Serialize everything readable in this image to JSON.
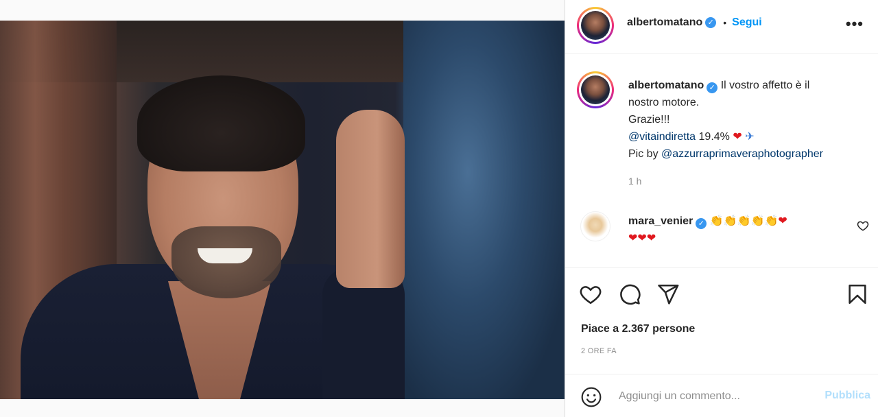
{
  "post": {
    "author": "albertomatano",
    "follow_label": "Segui",
    "dot": "•",
    "more_label": "•••"
  },
  "caption": {
    "author": "albertomatano",
    "line1": "Il vostro affetto è il",
    "line2": "nostro motore.",
    "line3": "Grazie!!!",
    "mention1": "@vitaindiretta",
    "stat": "19.4%",
    "heart": "❤",
    "plane": "✈",
    "pic_by": "Pic by",
    "mention2": "@azzurraprimaveraphotographer",
    "time": "1 h"
  },
  "comment": {
    "author": "mara_venier",
    "clap_emojis": "👏👏👏👏👏",
    "hearts_inline": "❤",
    "hearts_line2": "❤❤❤"
  },
  "likes": "Piace a 2.367 persone",
  "posted_ago": "2 ORE FA",
  "add_comment": {
    "placeholder": "Aggiungi un commento...",
    "publish_label": "Pubblica"
  },
  "icons": {
    "like": "heart-icon",
    "comment": "comment-icon",
    "share": "share-icon",
    "save": "bookmark-icon",
    "emoji": "emoji-icon",
    "verified": "verified-badge-icon"
  },
  "colors": {
    "link": "#0095f6",
    "mention": "#00376b",
    "verified": "#3897f0",
    "publish_disabled": "#b2dffc",
    "muted": "#8e8e8e"
  }
}
